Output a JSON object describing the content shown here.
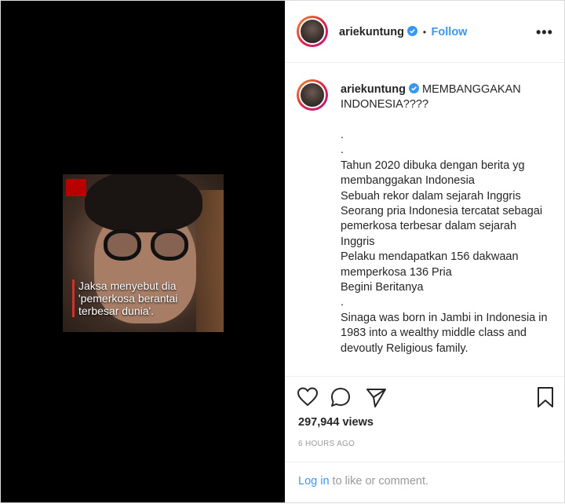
{
  "media": {
    "caption_line1": "Jaksa menyebut dia",
    "caption_line2": "'pemerkosa berantai",
    "caption_line3": "terbesar dunia'."
  },
  "header": {
    "username": "ariekuntung",
    "separator": "•",
    "follow_label": "Follow",
    "more_label": "•••"
  },
  "post": {
    "username": "ariekuntung",
    "headline": "MEMBANGGAKAN INDONESIA????",
    "body": ".\n.\nTahun 2020 dibuka dengan berita yg membanggakan Indonesia\nSebuah rekor dalam sejarah Inggris\nSeorang pria Indonesia tercatat sebagai pemerkosa terbesar dalam sejarah Inggris\nPelaku mendapatkan 156 dakwaan memperkosa 136 Pria\nBegini Beritanya\n.\nSinaga was born in Jambi in Indonesia in 1983 into a wealthy middle class and devoutly Religious family."
  },
  "stats": {
    "views": "297,944 views",
    "time": "6 HOURS AGO"
  },
  "login": {
    "link": "Log in",
    "rest": " to like or comment."
  },
  "colors": {
    "accent": "#3897f0",
    "muted": "#999999",
    "text": "#262626"
  }
}
